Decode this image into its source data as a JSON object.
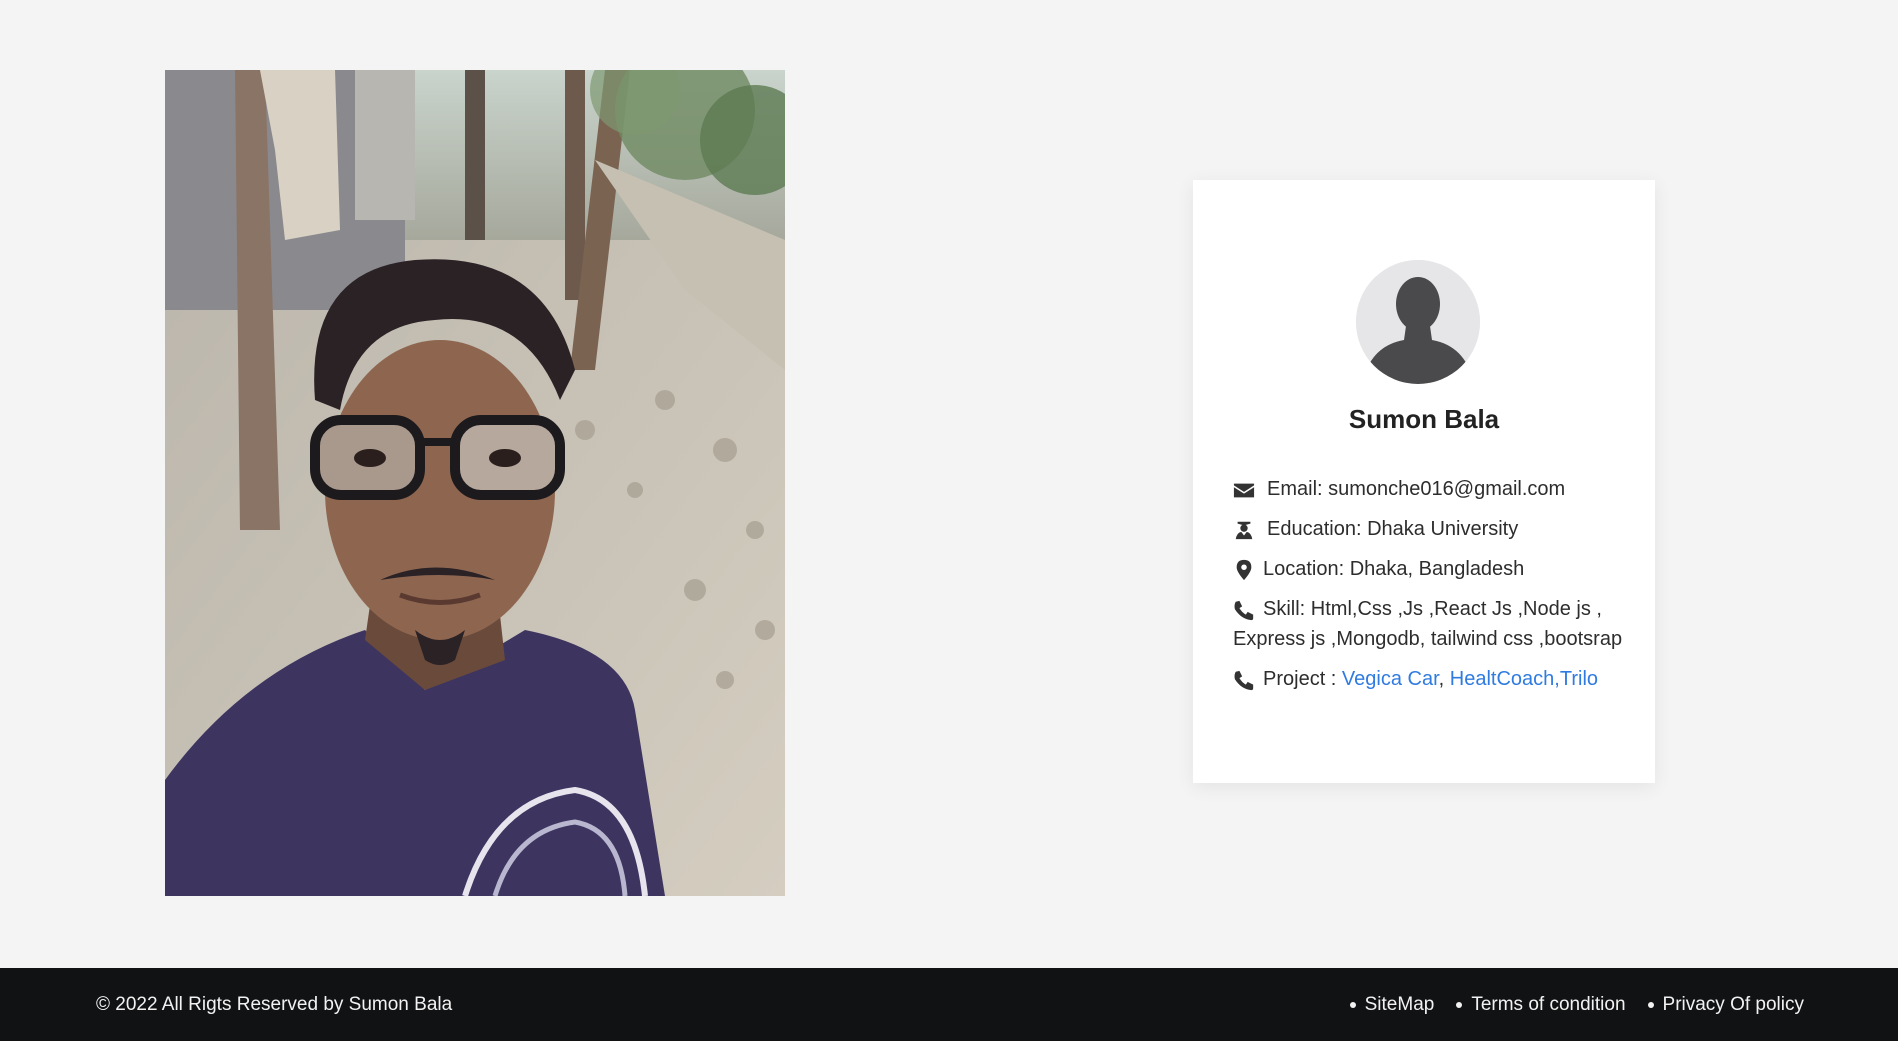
{
  "photo": {
    "alt": ""
  },
  "card": {
    "name": "Sumon Bala",
    "email_label": "Email: ",
    "email_value": "sumonche016@gmail.com",
    "education_label": "Education: ",
    "education_value": "Dhaka University",
    "location_label": "Location: ",
    "location_value": "Dhaka, Bangladesh",
    "skill_label": "Skill: ",
    "skill_value": "Html,Css ,Js ,React Js ,Node js , Express js ,Mongodb, tailwind css ,bootsrap",
    "project_label": "Project : ",
    "projects": [
      {
        "label": "Vegica Car"
      },
      {
        "label": "HealtCoach"
      },
      {
        "label": "Trilo"
      }
    ],
    "sep1": ", ",
    "sep2": ","
  },
  "footer": {
    "copyright": "© 2022 All Rigts Reserved by Sumon Bala",
    "links": [
      {
        "label": "SiteMap"
      },
      {
        "label": "Terms of condition"
      },
      {
        "label": "Privacy Of policy"
      }
    ]
  },
  "icons": {
    "email": "envelope-icon",
    "education": "graduate-icon",
    "location": "map-marker-icon",
    "skill": "phone-icon",
    "project": "phone-icon"
  },
  "colors": {
    "link": "#2f7be0",
    "footer_bg": "#111214",
    "page_bg": "#f4f4f4"
  }
}
